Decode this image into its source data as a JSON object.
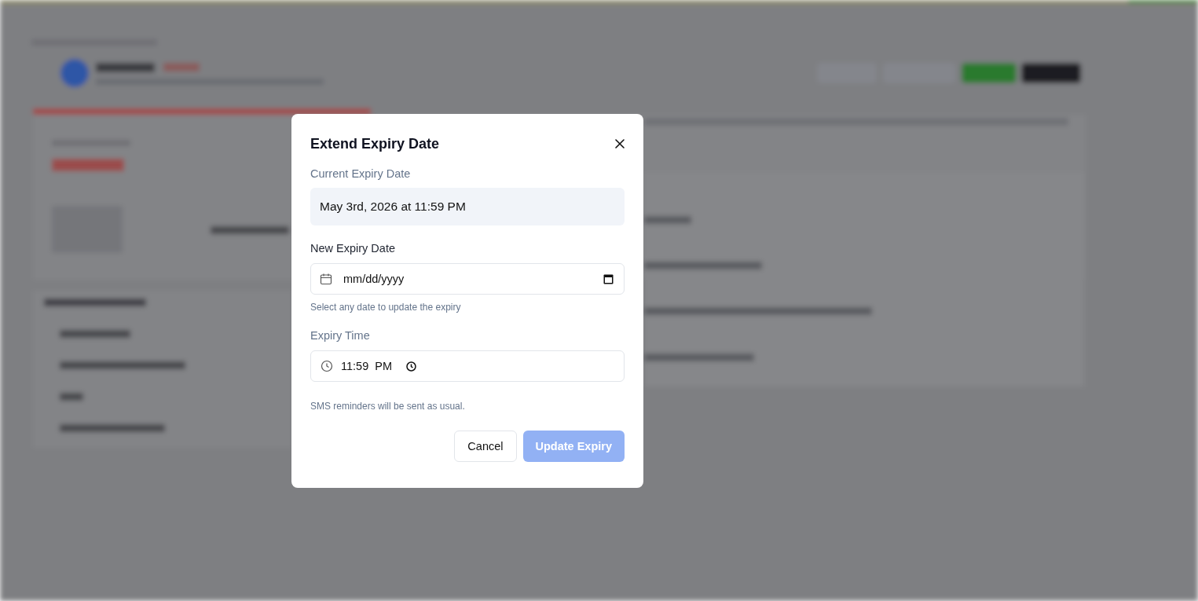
{
  "dialog": {
    "title": "Extend Expiry Date",
    "current": {
      "label": "Current Expiry Date",
      "value": "May 3rd, 2026 at 11:59 PM"
    },
    "new_date": {
      "label": "New Expiry Date",
      "placeholder": "mm/dd/yyyy",
      "hint": "Select any date to update the expiry"
    },
    "time": {
      "label": "Expiry Time",
      "value": "11:59  PM"
    },
    "note": "SMS reminders will be sent as usual.",
    "buttons": [
      {
        "label": "Cancel",
        "kind": "secondary",
        "disabled": false
      },
      {
        "label": "Update Expiry",
        "kind": "primary",
        "disabled": true
      }
    ]
  }
}
